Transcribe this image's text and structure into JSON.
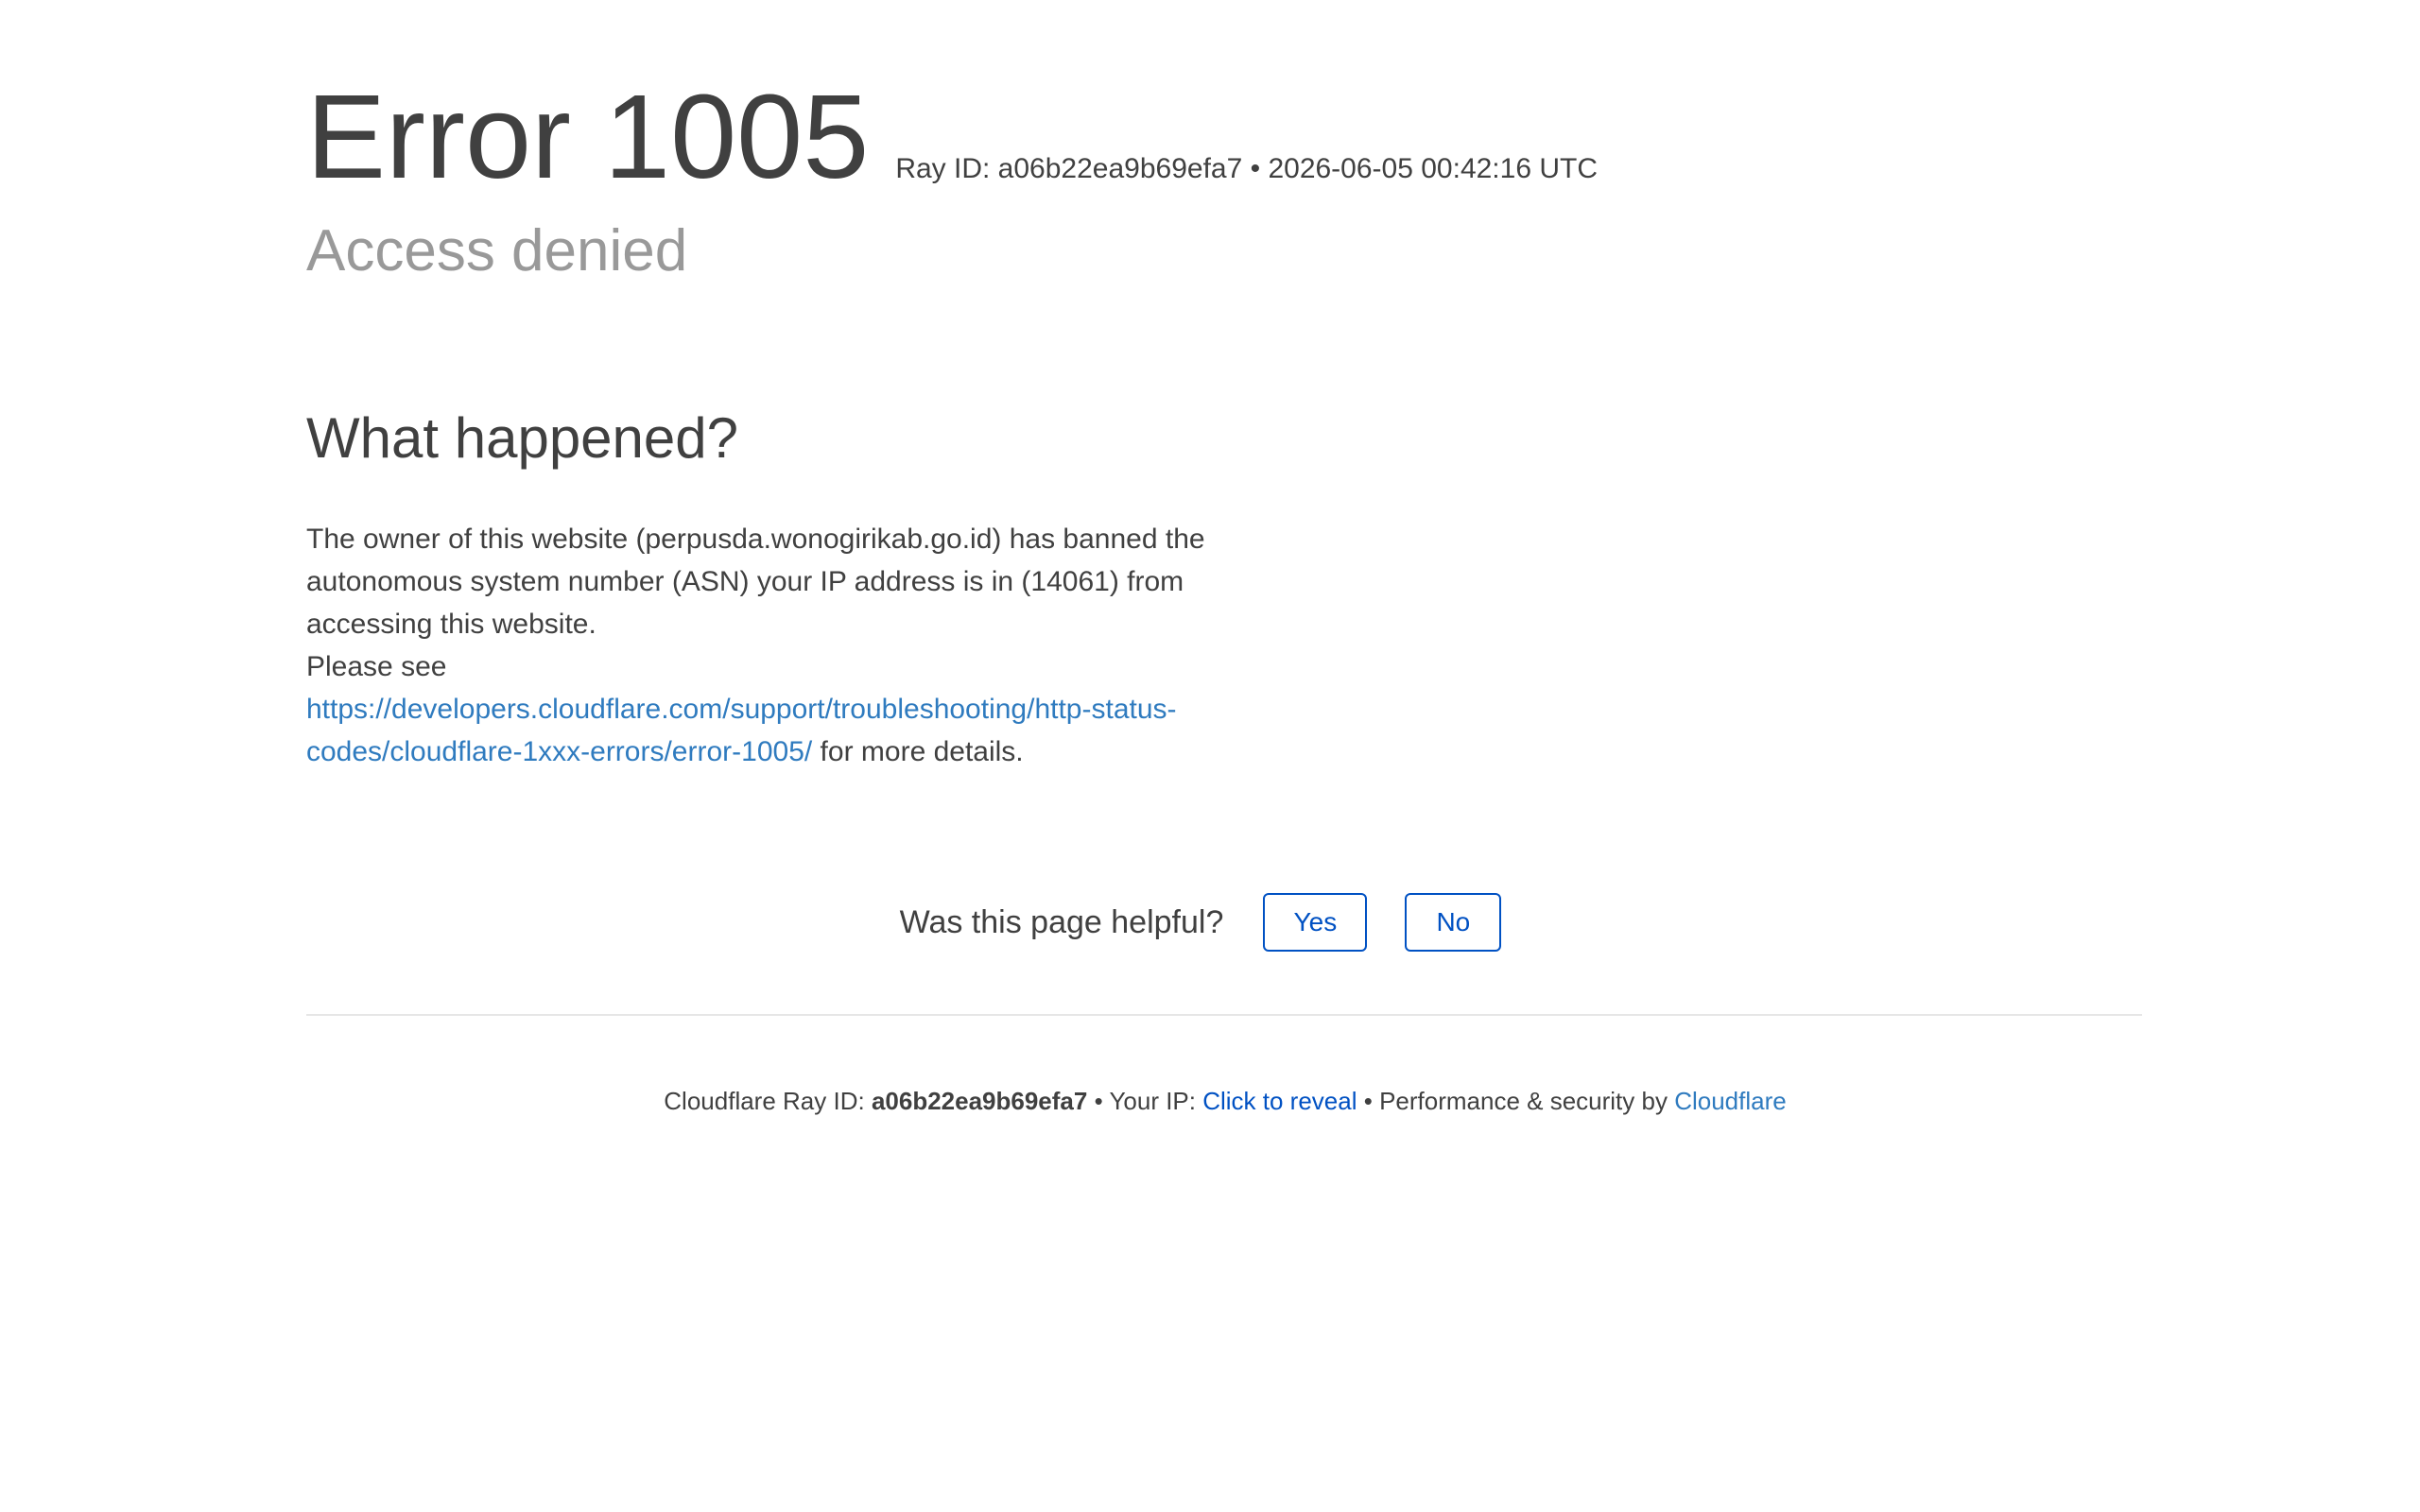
{
  "header": {
    "title": "Error 1005",
    "ray_label": "Ray ID: a06b22ea9b69efa7 • 2026-06-05 00:42:16 UTC",
    "subtitle": "Access denied"
  },
  "what_happened": {
    "heading": "What happened?",
    "paragraph": "The owner of this website (perpusda.wonogirikab.go.id) has banned the autonomous system number (ASN) your IP address is in (14061) from accessing this website.",
    "please_see": "Please see",
    "link": "https://developers.cloudflare.com/support/troubleshooting/http-status-codes/cloudflare-1xxx-errors/error-1005/",
    "link_suffix": " for more details."
  },
  "feedback": {
    "question": "Was this page helpful?",
    "yes_label": "Yes",
    "no_label": "No"
  },
  "footer": {
    "ray_prefix": "Cloudflare Ray ID: ",
    "ray_id": "a06b22ea9b69efa7",
    "sep1": " • ",
    "ip_prefix": "Your IP: ",
    "reveal_label": "Click to reveal",
    "sep2": " • ",
    "perf_prefix": "Performance & security by ",
    "cloudflare_link": "Cloudflare"
  },
  "colors": {
    "text": "#404040",
    "subtitle": "#999999",
    "link": "#2f7bbf",
    "button": "#0051c3",
    "divider": "#e6e6e6"
  }
}
